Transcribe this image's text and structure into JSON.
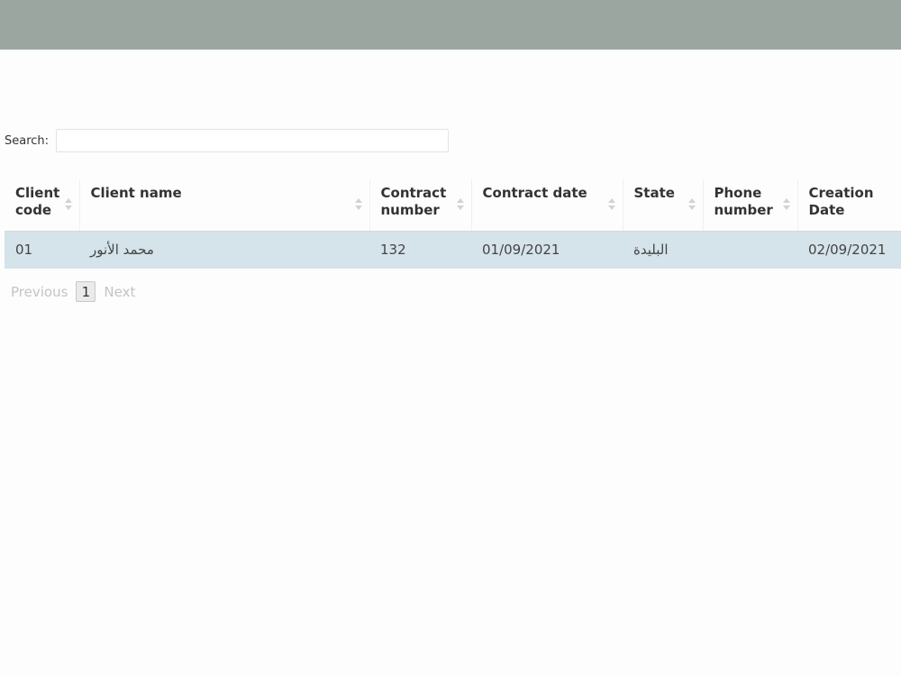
{
  "search": {
    "label": "Search:",
    "value": "",
    "placeholder": ""
  },
  "table": {
    "columns": [
      {
        "label": "Client code"
      },
      {
        "label": "Client name"
      },
      {
        "label": "Contract number"
      },
      {
        "label": "Contract date"
      },
      {
        "label": "State"
      },
      {
        "label": "Phone number"
      },
      {
        "label": "Creation Date"
      }
    ],
    "rows": [
      {
        "client_code": "01",
        "client_name": "محمد الأنور",
        "contract_number": "132",
        "contract_date": "01/09/2021",
        "state": "البليدة",
        "phone_number": "",
        "creation_date": "02/09/2021"
      }
    ]
  },
  "pagination": {
    "previous_label": "Previous",
    "current_page": "1",
    "next_label": "Next"
  },
  "colors": {
    "topbar": "#9ca6a1",
    "row_highlight": "#d5e3ea"
  }
}
